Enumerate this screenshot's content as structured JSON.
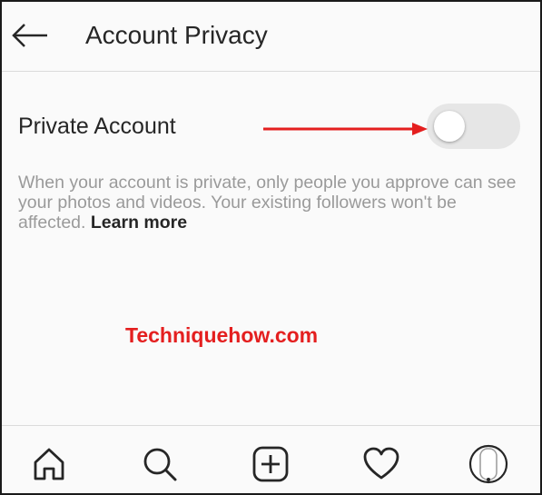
{
  "header": {
    "back_icon": "arrow-left-icon",
    "title": "Account Privacy"
  },
  "privacy": {
    "label": "Private Account",
    "toggle_on": false,
    "description": "When your account is private, only people you approve can see your photos and videos. Your existing followers won't be affected.",
    "learn_more": "Learn more"
  },
  "watermark": "Techniquehow.com",
  "colors": {
    "arrow": "#e41f1f",
    "watermark": "#e41f1f",
    "toggle_track": "#e6e6e6",
    "text_primary": "#262626",
    "text_secondary": "#9a9a9a"
  },
  "bottom_nav": {
    "items": [
      {
        "icon": "home-icon"
      },
      {
        "icon": "search-icon"
      },
      {
        "icon": "add-post-icon"
      },
      {
        "icon": "heart-icon"
      },
      {
        "icon": "profile-avatar-icon"
      }
    ]
  }
}
